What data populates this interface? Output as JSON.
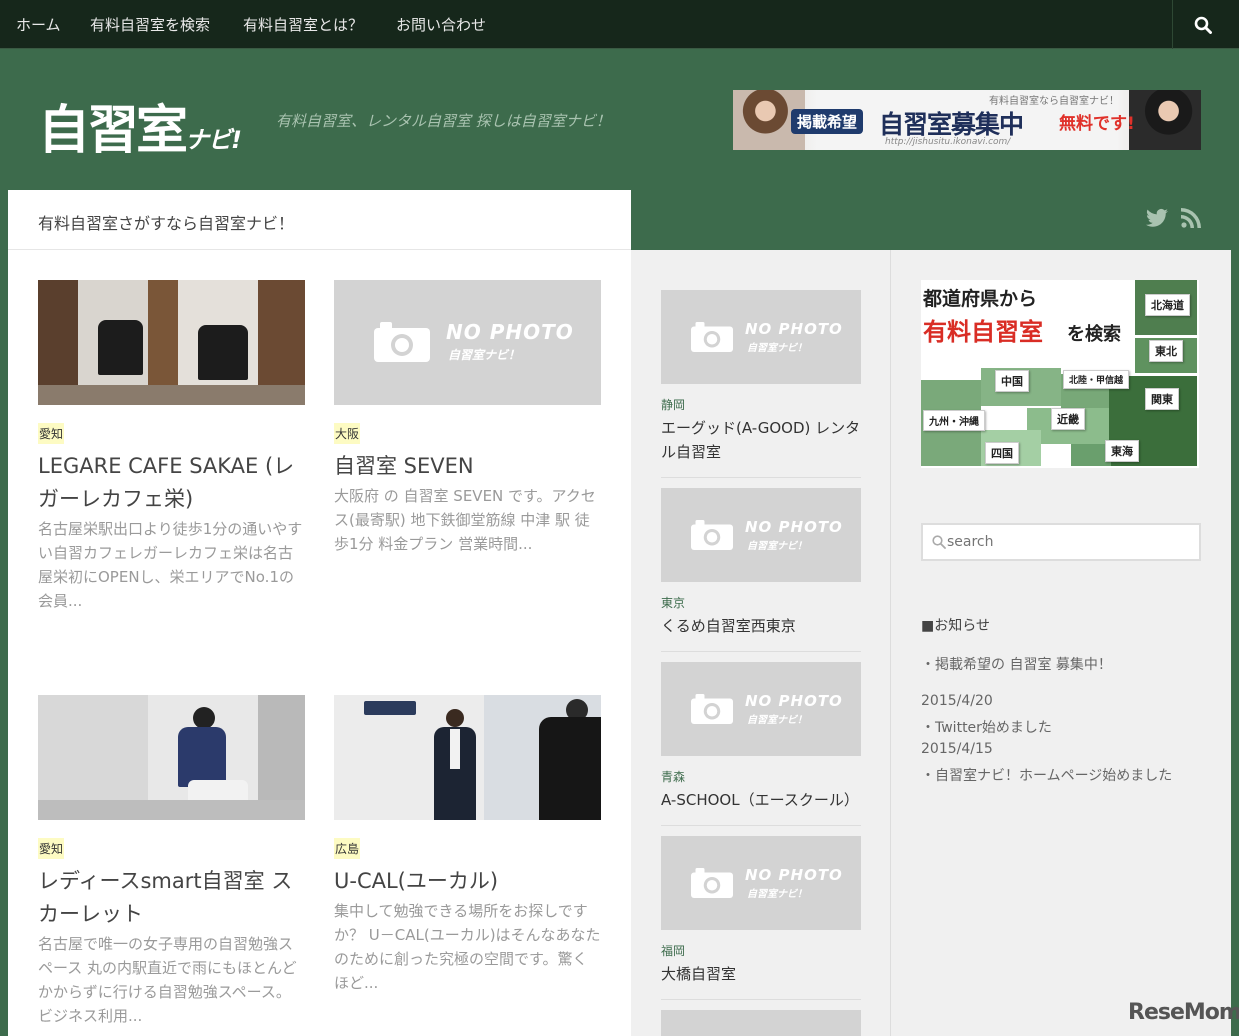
{
  "nav": {
    "items": [
      "ホーム",
      "有料自習室を検索",
      "有料自習室とは？",
      "お問い合わせ"
    ],
    "search_icon": "search-icon"
  },
  "header": {
    "logo_main": "自習室",
    "logo_suffix": "ナビ!",
    "tagline": "有料自習室、レンタル自習室 探しは自習室ナビ！",
    "banner": {
      "top_text": "有料自習室なら自習室ナビ！",
      "pill": "掲載希望",
      "main": "自習室募集中",
      "red": "無料です!",
      "url": "http://jishusitu.ikonavi.com/"
    }
  },
  "page": {
    "heading": "有料自習室さがすなら自習室ナビ！",
    "social": [
      "twitter-icon",
      "rss-icon"
    ]
  },
  "nophoto": {
    "line1": "NO PHOTO",
    "line2": "自習室ナビ！"
  },
  "posts": [
    {
      "category": "愛知",
      "title": "LEGARE CAFE SAKAE (レガーレカフェ栄)",
      "excerpt": "名古屋栄駅出口より徒歩1分の通いやすい自習カフェレガーレカフェ栄は名古屋栄初にOPENし、栄エリアでNo.1の会員...",
      "image": "office-photo"
    },
    {
      "category": "大阪",
      "title": "自習室 SEVEN",
      "excerpt": "大阪府 の 自習室 SEVEN です。アクセス(最寄駅) 地下鉄御堂筋線 中津 駅 徒歩1分 料金プラン 営業時間...",
      "image": "no-photo"
    },
    {
      "category": "愛知",
      "title": "レディースsmart自習室 スカーレット",
      "excerpt": "名古屋で唯一の女子専用の自習勉強スペース 丸の内駅直近で雨にもほとんどかからずに行ける自習勉強スペース。ビジネス利用...",
      "image": "booth-photo"
    },
    {
      "category": "広島",
      "title": "U-CAL(ユーカル)",
      "excerpt": "集中して勉強できる場所をお探しですか？ U－CAL(ユーカル)はそんなあなたのために創った究極の空間です。驚くほど...",
      "image": "reception-photo"
    }
  ],
  "sidebar_list": [
    {
      "prefecture": "静岡",
      "name": "エーグッド(A-GOOD) レンタル自習室"
    },
    {
      "prefecture": "東京",
      "name": "くるめ自習室西東京"
    },
    {
      "prefecture": "青森",
      "name": "A-SCHOOL（エースクール）"
    },
    {
      "prefecture": "福岡",
      "name": "大橋自習室"
    }
  ],
  "map_widget": {
    "line1": "都道府県から",
    "line2": "有料自習室",
    "line3": "を検索",
    "regions": [
      "北海道",
      "東北",
      "中国",
      "北陸・甲信越",
      "関東",
      "九州・沖縄",
      "近畿",
      "四国",
      "東海"
    ]
  },
  "search": {
    "placeholder": "search"
  },
  "news": {
    "title": "■お知らせ",
    "items": [
      "・掲載希望の 自習室 募集中！",
      "2015/4/20",
      "・Twitter始めました",
      "2015/4/15",
      "・自習室ナビ！ホームページ始めました"
    ]
  },
  "watermark": "ReseMom"
}
